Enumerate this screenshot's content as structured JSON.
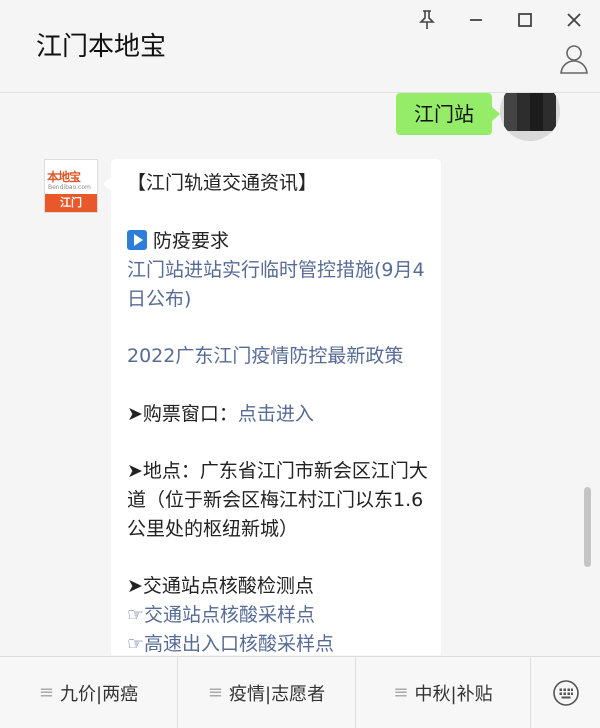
{
  "window": {
    "title": "江门本地宝",
    "icons": [
      "pin-icon",
      "minimize-icon",
      "maximize-icon",
      "close-icon",
      "profile-icon"
    ]
  },
  "chat": {
    "sent": {
      "text": "江门站"
    },
    "bot_avatar": {
      "logo_text": "本地宝",
      "sub_text": "Bendibao.com",
      "city": "江门"
    },
    "received": {
      "heading": "【江门轨道交通资讯】",
      "section_prevention": "防疫要求",
      "link1": "江门站进站实行临时管控措施(9月4日公布)",
      "link2": "2022广东江门疫情防控最新政策",
      "ticket_label": "➤购票窗口：",
      "ticket_link": "点击进入",
      "location": "➤地点：广东省江门市新会区江门大道（位于新会区梅江村江门以东1.6公里处的枢纽新城）",
      "testing_label": "➤交通站点核酸检测点",
      "testing_link1": "☞交通站点核酸采样点",
      "testing_link2": "☞高速出入口核酸采样点"
    }
  },
  "menu": {
    "items": [
      "九价|两癌",
      "疫情|志愿者",
      "中秋|补贴"
    ],
    "keyboard_icon": "keyboard-icon"
  }
}
